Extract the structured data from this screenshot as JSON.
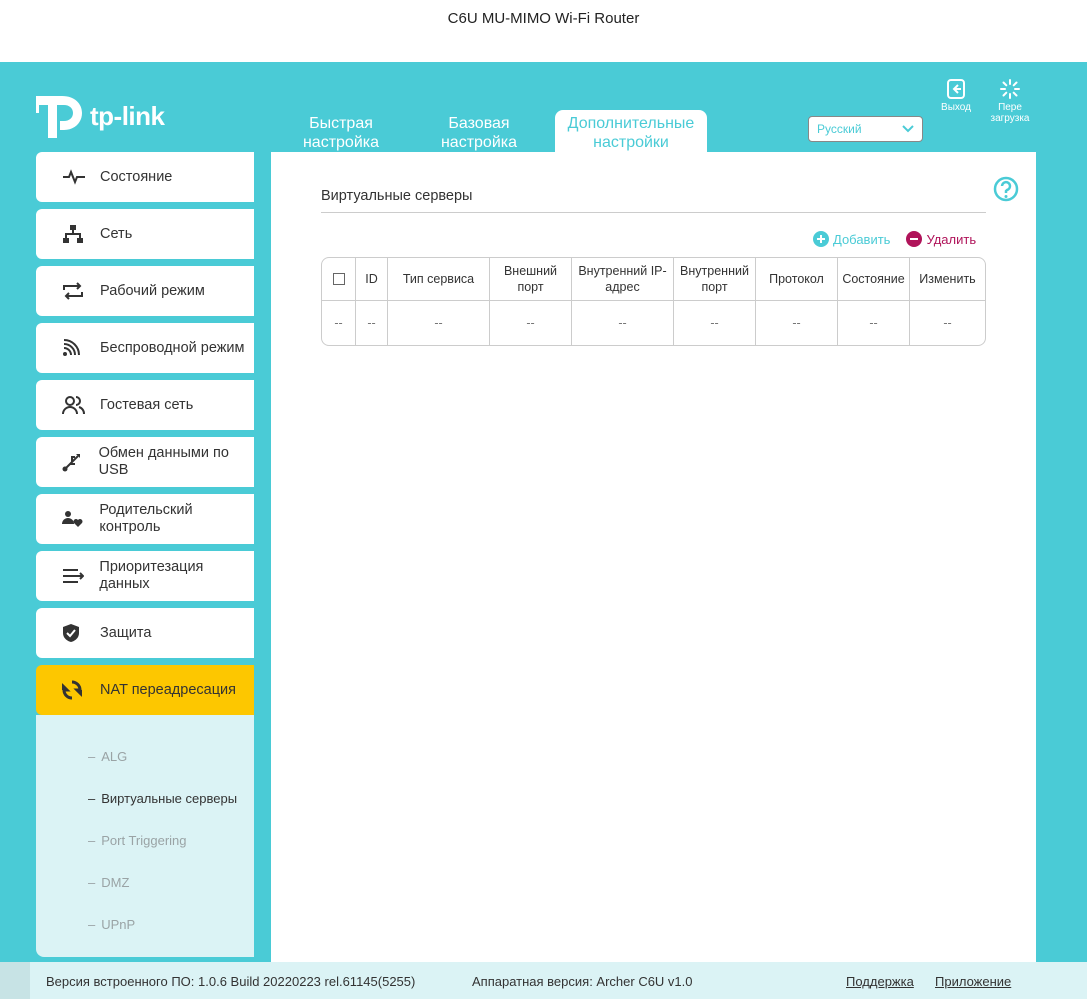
{
  "window": {
    "title": "C6U MU-MIMO Wi-Fi Router"
  },
  "brand": {
    "logo_text": "tp-link"
  },
  "tabs": [
    {
      "line1": "Быстрая",
      "line2": "настройка"
    },
    {
      "line1": "Базовая",
      "line2": "настройка"
    },
    {
      "line1": "Дополнительные",
      "line2": "настройки"
    }
  ],
  "language": {
    "selected": "Русский"
  },
  "top_buttons": {
    "logout": "Выход",
    "reboot_line1": "Пере",
    "reboot_line2": "загрузка"
  },
  "sidebar": {
    "items": [
      {
        "label": "Состояние",
        "icon": "pulse-icon"
      },
      {
        "label": "Сеть",
        "icon": "network-icon"
      },
      {
        "label": "Рабочий режим",
        "icon": "mode-switch-icon"
      },
      {
        "label": "Беспроводной режим",
        "icon": "wifi-icon"
      },
      {
        "label": "Гостевая сеть",
        "icon": "guests-icon"
      },
      {
        "label": "Обмен данными по USB",
        "icon": "usb-icon"
      },
      {
        "label": "Родительский контроль",
        "icon": "parental-icon"
      },
      {
        "label": "Приоритезация данных",
        "icon": "qos-icon"
      },
      {
        "label": "Защита",
        "icon": "shield-icon"
      },
      {
        "label": "NAT переадресация",
        "icon": "nat-icon"
      }
    ],
    "sub_items": [
      "ALG",
      "Виртуальные серверы",
      "Port Triggering",
      "DMZ",
      "UPnP"
    ]
  },
  "main": {
    "section_title": "Виртуальные серверы",
    "add_label": "Добавить",
    "delete_label": "Удалить",
    "table": {
      "headers": [
        "",
        "ID",
        "Тип сервиса",
        "Внешний порт",
        "Внутренний IP-адрес",
        "Внутренний порт",
        "Протокол",
        "Состояние",
        "Изменить"
      ],
      "rows": [
        [
          "--",
          "--",
          "--",
          "--",
          "--",
          "--",
          "--",
          "--",
          "--"
        ]
      ]
    }
  },
  "footer": {
    "firmware": "Версия встроенного ПО: 1.0.6 Build 20220223 rel.61145(5255)",
    "hardware": "Аппаратная версия: Archer C6U v1.0",
    "support": "Поддержка",
    "app": "Приложение"
  },
  "colors": {
    "accent": "#4acbd6",
    "active_nav": "#fdc700",
    "delete": "#b0145a"
  }
}
